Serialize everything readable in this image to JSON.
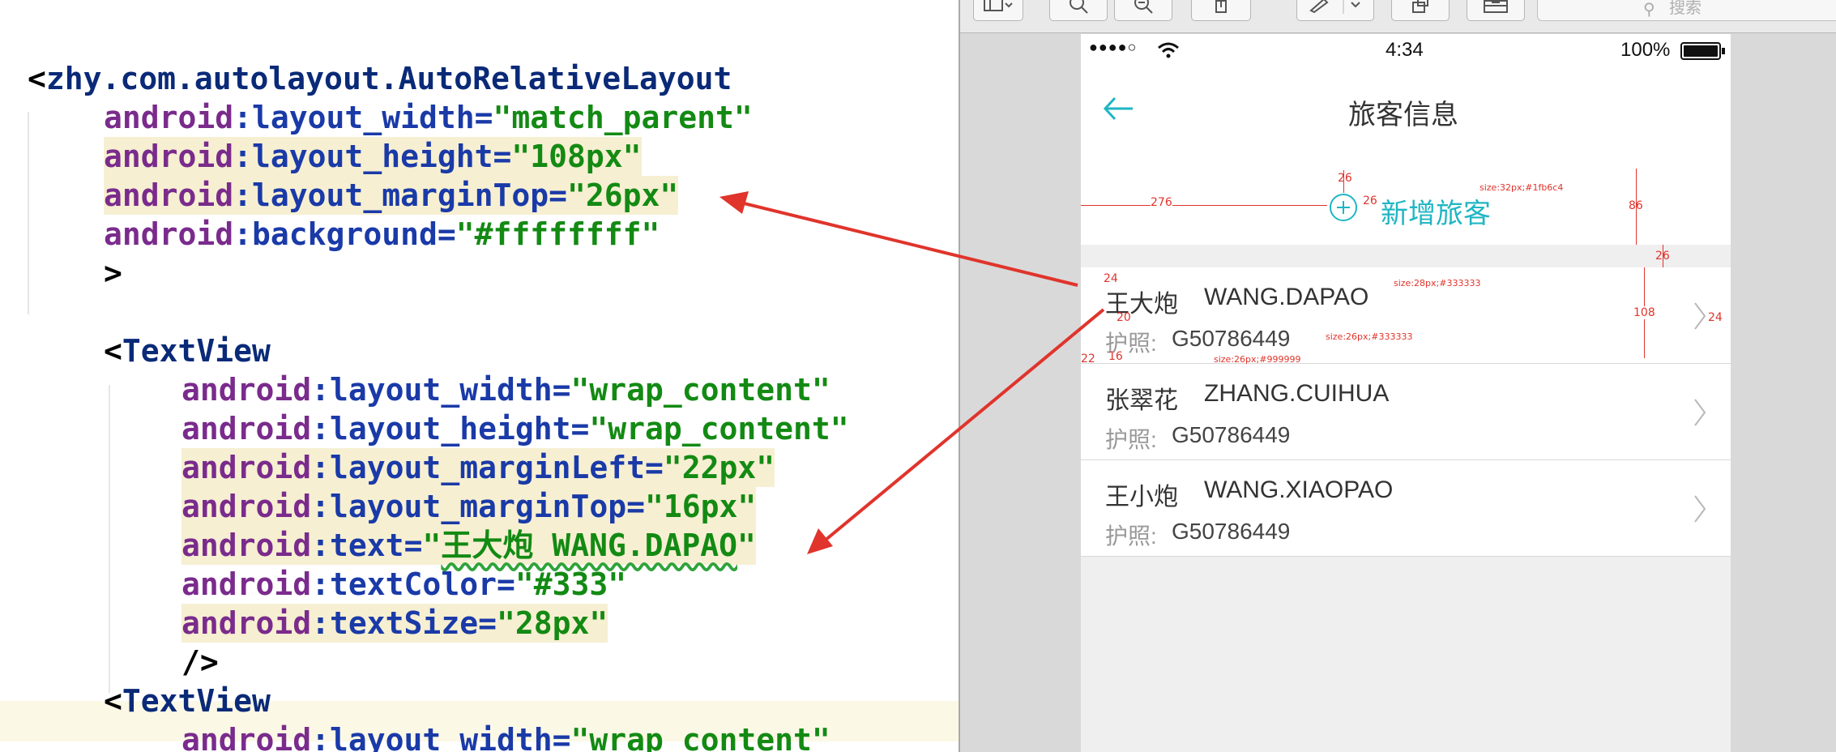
{
  "editor": {
    "lines": [
      {
        "kind": "open",
        "tag": "zhy.com.autolayout.AutoRelativeLayout"
      },
      {
        "kind": "attr",
        "ns": "android",
        "name": "layout_width",
        "value": "match_parent"
      },
      {
        "kind": "attr",
        "ns": "android",
        "name": "layout_height",
        "value": "108px",
        "highlight": true
      },
      {
        "kind": "attr",
        "ns": "android",
        "name": "layout_marginTop",
        "value": "26px",
        "highlight": true
      },
      {
        "kind": "attr",
        "ns": "android",
        "name": "background",
        "value": "#ffffffff"
      },
      {
        "kind": "close",
        "text": ">"
      },
      {
        "kind": "blank"
      },
      {
        "kind": "open",
        "tag": "TextView"
      },
      {
        "kind": "attr",
        "ns": "android",
        "name": "layout_width",
        "value": "wrap_content"
      },
      {
        "kind": "attr",
        "ns": "android",
        "name": "layout_height",
        "value": "wrap_content"
      },
      {
        "kind": "attr",
        "ns": "android",
        "name": "layout_marginLeft",
        "value": "22px",
        "highlight": true
      },
      {
        "kind": "attr",
        "ns": "android",
        "name": "layout_marginTop",
        "value": "16px",
        "highlight": true
      },
      {
        "kind": "attr",
        "ns": "android",
        "name": "text",
        "value": "王大炮 WANG.DAPAO",
        "highlight": true,
        "wavy": "DAPAO"
      },
      {
        "kind": "attr",
        "ns": "android",
        "name": "textColor",
        "value": "#333"
      },
      {
        "kind": "attr",
        "ns": "android",
        "name": "textSize",
        "value": "28px",
        "highlight": true
      },
      {
        "kind": "close",
        "text": "/>"
      },
      {
        "kind": "open",
        "tag": "TextView"
      },
      {
        "kind": "attr",
        "ns": "android",
        "name": "layout_width",
        "value": "wrap_content"
      }
    ]
  },
  "viewer": {
    "search_placeholder": "搜索",
    "toolbar_icons": [
      "sidebar-icon",
      "zoom-out-icon",
      "zoom-in-icon",
      "share-icon",
      "markup-icon",
      "rotate-icon",
      "toolbox-icon"
    ]
  },
  "phone": {
    "status": {
      "carrier_signal": "●●●●○",
      "time": "4:34",
      "battery": "100%"
    },
    "title": "旅客信息",
    "add_label": "新增旅客",
    "accent_color": "#1fb6c4",
    "passengers": [
      {
        "name": "王大炮",
        "pinyin": "WANG.DAPAO",
        "passport_label": "护照:",
        "passport": "G50786449"
      },
      {
        "name": "张翠花",
        "pinyin": "ZHANG.CUIHUA",
        "passport_label": "护照:",
        "passport": "G50786449"
      },
      {
        "name": "王小炮",
        "pinyin": "WANG.XIAOPAO",
        "passport_label": "护照:",
        "passport": "G50786449"
      }
    ]
  },
  "annotations": {
    "add_left": "276",
    "add_top": "26",
    "add_gap": "26",
    "add_height": "86",
    "add_size": "size:32px;#1fb6c4",
    "row_gap": "26",
    "name_top": "24",
    "name_size": "size:28px;#333333",
    "name_gap": "20",
    "passport_size": "size:26px;#333333",
    "row_height": "108",
    "label_left": "22",
    "label_gap": "16",
    "label_size": "size:26px;#999999",
    "arrow_right": "24"
  }
}
